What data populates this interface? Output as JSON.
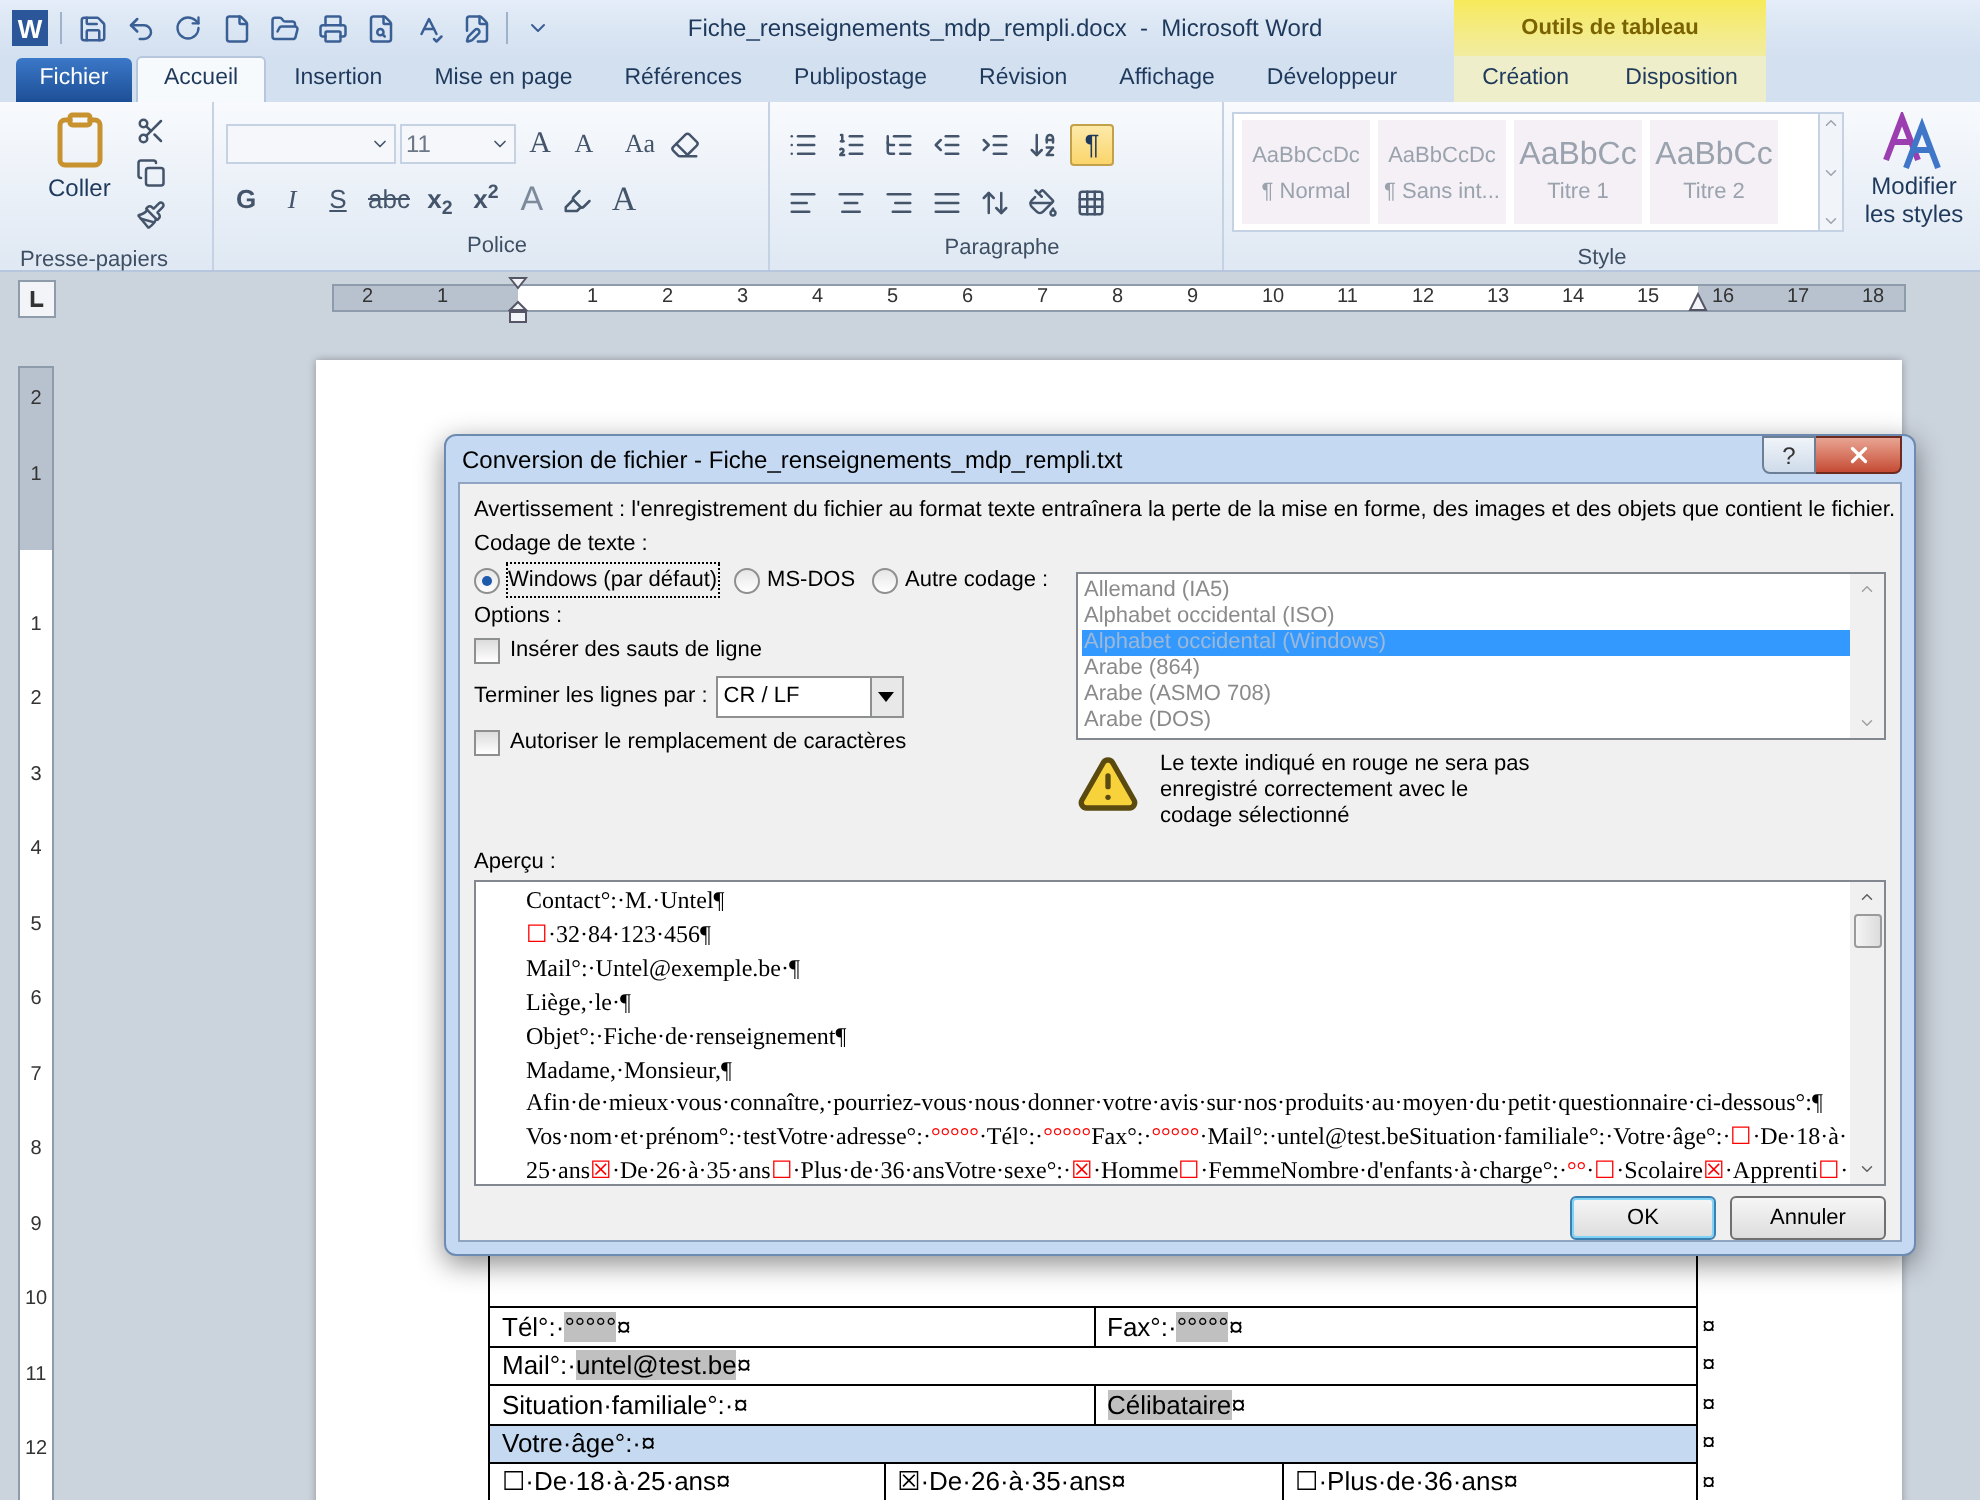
{
  "window": {
    "logo": "W",
    "title": "Fiche_renseignements_mdp_rempli.docx  -  Microsoft Word",
    "contextual_group": "Outils de tableau"
  },
  "tabs": [
    {
      "label": "Fichier",
      "kind": "file",
      "selected": false
    },
    {
      "label": "Accueil",
      "kind": "normal",
      "selected": true
    },
    {
      "label": "Insertion",
      "kind": "normal",
      "selected": false
    },
    {
      "label": "Mise en page",
      "kind": "normal",
      "selected": false
    },
    {
      "label": "Références",
      "kind": "normal",
      "selected": false
    },
    {
      "label": "Publipostage",
      "kind": "normal",
      "selected": false
    },
    {
      "label": "Révision",
      "kind": "normal",
      "selected": false
    },
    {
      "label": "Affichage",
      "kind": "normal",
      "selected": false
    },
    {
      "label": "Développeur",
      "kind": "normal",
      "selected": false
    },
    {
      "label": "Création",
      "kind": "contextual",
      "selected": false
    },
    {
      "label": "Disposition",
      "kind": "contextual",
      "selected": false
    }
  ],
  "ribbon": {
    "clipboard": {
      "paste": "Coller",
      "group_label": "Presse-papiers"
    },
    "font": {
      "size": "11",
      "grow": "A",
      "shrink": "A",
      "case": "Aa",
      "bold": "G",
      "italic": "I",
      "underline": "S",
      "strike": "abc",
      "subscript": "x$_{2}$",
      "superscript": "x$^{2}$",
      "effects": "A",
      "font_color_letter": "A",
      "group_label": "Police"
    },
    "paragraph": {
      "show_marks": {
        "symbol": "¶",
        "on": true
      },
      "group_label": "Paragraphe"
    },
    "styles": {
      "items": [
        {
          "sample": "AaBbCcDc",
          "label": "¶ Normal",
          "kind": "body"
        },
        {
          "sample": "AaBbCcDc",
          "label": "¶ Sans int...",
          "kind": "body"
        },
        {
          "sample": "AaBbCc",
          "label": "Titre 1",
          "kind": "heading"
        },
        {
          "sample": "AaBbCc",
          "label": "Titre 2",
          "kind": "heading"
        }
      ],
      "group_label": "Style",
      "change": "Modifier les styles"
    }
  },
  "ruler": {
    "h_before": [
      "2",
      "1"
    ],
    "h_after": [
      "1",
      "2",
      "3",
      "4",
      "5",
      "6",
      "7",
      "8",
      "9",
      "10",
      "11",
      "12",
      "13",
      "14",
      "15",
      "16",
      "17",
      "18"
    ],
    "v_before": [
      "2",
      "1"
    ],
    "v_after": [
      "1",
      "2",
      "3",
      "4",
      "5",
      "6",
      "7",
      "8",
      "9",
      "10",
      "11",
      "12"
    ]
  },
  "table": {
    "rows": [
      {
        "kind": "empty"
      },
      {
        "kind": "fields",
        "end": "¤",
        "cells": [
          {
            "text": "Tél°:·",
            "field": "°°°°°",
            "end": "¤"
          },
          {
            "text": "Fax°:·",
            "field": "°°°°°",
            "end": "¤"
          }
        ]
      },
      {
        "kind": "fields",
        "end": "¤",
        "cells": [
          {
            "text": "Mail°:·",
            "field": "untel@test.be",
            "end": "¤"
          }
        ]
      },
      {
        "kind": "fields",
        "end": "¤",
        "cells": [
          {
            "text": "Situation·familiale°:·",
            "end": "¤"
          },
          {
            "field": "Célibataire",
            "end": "¤"
          }
        ]
      },
      {
        "kind": "section",
        "end": "¤",
        "cells": [
          {
            "text": "Votre·âge°:·",
            "end": "¤"
          }
        ]
      },
      {
        "kind": "fields",
        "end": "¤",
        "cells": [
          {
            "box": "☐",
            "text": "·De·18·à·25·ans",
            "end": "¤"
          },
          {
            "box": "☒",
            "text": "·De·26·à·35·ans",
            "end": "¤"
          },
          {
            "box": "☐",
            "text": "·Plus·de·36·ans",
            "end": "¤"
          }
        ]
      }
    ]
  },
  "dialog": {
    "title": "Conversion de fichier - Fiche_renseignements_mdp_rempli.txt",
    "help": "?",
    "warning": "Avertissement : l'enregistrement du fichier au format texte entraînera la perte de la mise en forme, des images et des objets que contient le fichier.",
    "encoding_label": "Codage de texte :",
    "encodings": [
      {
        "label": "Windows (par défaut)",
        "selected": true
      },
      {
        "label": "MS-DOS",
        "selected": false
      },
      {
        "label": "Autre codage :",
        "selected": false
      }
    ],
    "encoding_list": {
      "disabled": true,
      "items": [
        {
          "label": "Allemand (IA5)",
          "selected": false
        },
        {
          "label": "Alphabet occidental (ISO)",
          "selected": false
        },
        {
          "label": "Alphabet occidental (Windows)",
          "selected": true
        },
        {
          "label": "Arabe (864)",
          "selected": false
        },
        {
          "label": "Arabe (ASMO 708)",
          "selected": false
        },
        {
          "label": "Arabe (DOS)",
          "selected": false
        }
      ]
    },
    "options_label": "Options :",
    "insert_breaks": {
      "label": "Insérer des sauts de ligne",
      "checked": false
    },
    "line_end": {
      "label": "Terminer les lignes par :",
      "value": "CR / LF"
    },
    "substitution": {
      "label": "Autoriser le remplacement de caractères",
      "checked": false
    },
    "notice": "Le texte indiqué en rouge ne sera pas enregistré correctement avec le codage sélectionné",
    "preview_label": "Aperçu :",
    "preview_lines": [
      [
        {
          "text": "Contact°:·M.·Untel¶",
          "lost": false
        }
      ],
      [
        {
          "text": "☐",
          "lost": true
        },
        {
          "text": "·32·84·123·456¶",
          "lost": false
        }
      ],
      [
        {
          "text": "Mail°:·Untel@exemple.be·¶",
          "lost": false
        }
      ],
      [
        {
          "text": "Liège,·le·¶",
          "lost": false
        }
      ],
      [
        {
          "text": "Objet°:·Fiche·de·renseignement¶",
          "lost": false
        }
      ],
      [
        {
          "text": "Madame,·Monsieur,¶",
          "lost": false
        }
      ],
      [
        {
          "text": "Afin·de·mieux·vous·connaître,·pourriez-vous·nous·donner·votre·avis·sur·nos·produits·au·moyen·du·petit·questionnaire·ci-dessous°:¶",
          "lost": false
        }
      ],
      [
        {
          "text": "Vos·nom·et·prénom°:·testVotre·adresse°:·",
          "lost": false
        },
        {
          "text": "°°°°°",
          "lost": true
        },
        {
          "text": "·Tél°:·",
          "lost": false
        },
        {
          "text": "°°°°°",
          "lost": true
        },
        {
          "text": "Fax°:·",
          "lost": false
        },
        {
          "text": "°°°°°",
          "lost": true
        },
        {
          "text": "·Mail°:·untel@test.beSituation·familiale°:·Votre·âge°:·",
          "lost": false
        },
        {
          "text": "☐",
          "lost": true
        },
        {
          "text": "·De·18·à·",
          "lost": false
        }
      ],
      [
        {
          "text": "25·ans",
          "lost": false
        },
        {
          "text": "☒",
          "lost": true
        },
        {
          "text": "·De·26·à·35·ans",
          "lost": false
        },
        {
          "text": "☐",
          "lost": true
        },
        {
          "text": "·Plus·de·36·ansVotre·sexe°:·",
          "lost": false
        },
        {
          "text": "☒",
          "lost": true
        },
        {
          "text": "·Homme",
          "lost": false
        },
        {
          "text": "☐",
          "lost": true
        },
        {
          "text": "·FemmeNombre·d'enfants·à·charge°:·",
          "lost": false
        },
        {
          "text": "°°",
          "lost": true
        },
        {
          "text": "·",
          "lost": false
        },
        {
          "text": "☐",
          "lost": true
        },
        {
          "text": "·Scolaire",
          "lost": false
        },
        {
          "text": "☒",
          "lost": true
        },
        {
          "text": "·Apprenti",
          "lost": false
        },
        {
          "text": "☐",
          "lost": true
        },
        {
          "text": "·",
          "lost": false
        }
      ]
    ],
    "buttons": [
      {
        "label": "OK",
        "default": true
      },
      {
        "label": "Annuler",
        "default": false
      }
    ]
  }
}
